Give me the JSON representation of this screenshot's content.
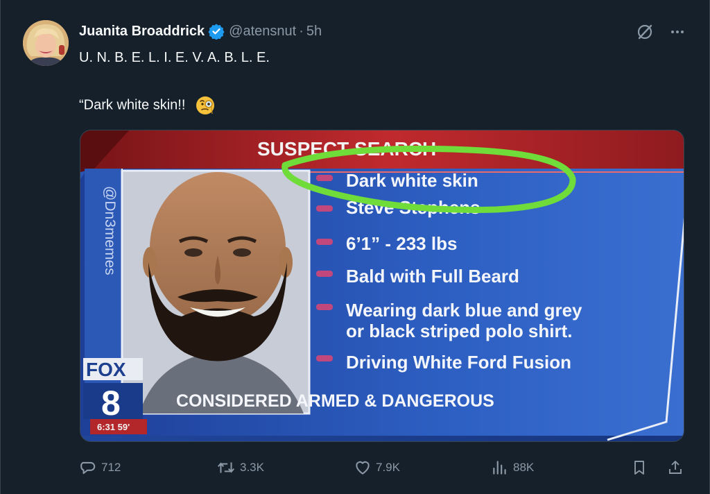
{
  "post": {
    "author_name": "Juanita Broaddrick",
    "handle": "@atensnut",
    "separator": "·",
    "time": "5h",
    "text_line1": "U. N. B. E. L. I. E. V. A. B. L. E.",
    "text_line2": "“Dark white skin!!"
  },
  "media": {
    "banner_title": "SUSPECT SEARCH",
    "watermark": "@Dn3memes",
    "items": [
      "Dark white skin",
      "Steve Stephens",
      "6’1” - 233 lbs",
      "Bald with Full Beard",
      "Wearing dark blue and grey",
      "or black striped polo shirt.",
      "Driving White Ford Fusion"
    ],
    "footer": "CONSIDERED ARMED & DANGEROUS",
    "channel_name": "FOX",
    "channel_number": "8",
    "clock": "6:31  59'"
  },
  "actions": {
    "replies": "712",
    "reposts": "3.3K",
    "likes": "7.9K",
    "views": "88K"
  },
  "colors": {
    "background": "#15202b",
    "secondary_text": "#8b98a5",
    "verified": "#1d9bf0",
    "highlight_circle": "#6fdc3a",
    "tv_blue": "#1f4aa6",
    "tv_red": "#b3262a"
  },
  "icons": [
    "verified-badge-icon",
    "grok-icon",
    "more-icon",
    "reply-icon",
    "repost-icon",
    "like-icon",
    "views-icon",
    "bookmark-icon",
    "share-icon"
  ]
}
